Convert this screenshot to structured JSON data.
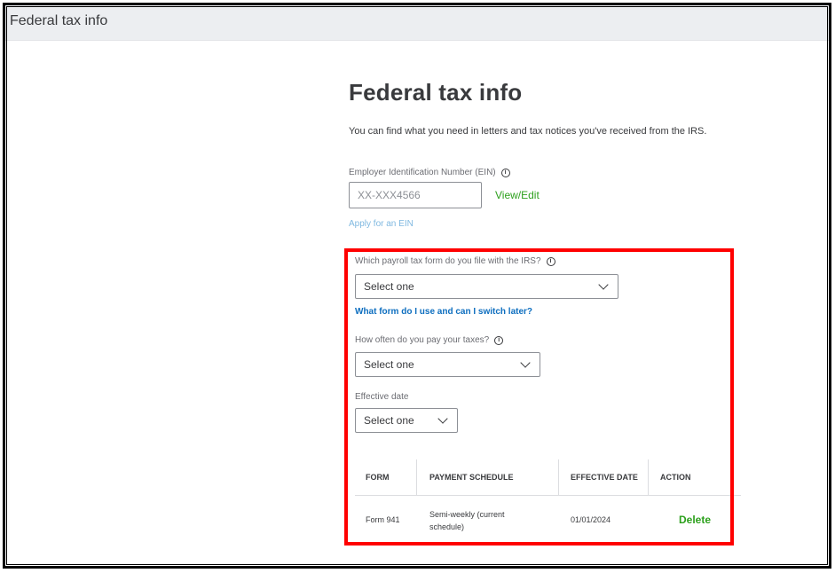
{
  "window": {
    "title": "Federal tax info"
  },
  "page": {
    "title": "Federal tax info",
    "description": "You can find what you need in letters and tax notices you've received from the IRS."
  },
  "ein": {
    "label": "Employer Identification Number (EIN)",
    "value": "XX-XXX4566",
    "view_edit_label": "View/Edit",
    "apply_link": "Apply for an EIN"
  },
  "payroll_form": {
    "label": "Which payroll tax form do you file with the IRS?",
    "selected": "Select one",
    "help_link": "What form do I use and can I switch later?"
  },
  "pay_frequency": {
    "label": "How often do you pay your taxes?",
    "selected": "Select one"
  },
  "effective_date": {
    "label": "Effective date",
    "selected": "Select one"
  },
  "table": {
    "headers": {
      "form": "FORM",
      "payment_schedule": "PAYMENT SCHEDULE",
      "effective_date": "EFFECTIVE DATE",
      "action": "ACTION"
    },
    "rows": [
      {
        "form": "Form 941",
        "payment_schedule": "Semi-weekly (current schedule)",
        "effective_date": "01/01/2024",
        "action": "Delete"
      }
    ]
  },
  "colors": {
    "brand_green": "#2ca01c",
    "link_blue": "#0d6ebf",
    "highlight_red": "#ff0000",
    "topbar_bg": "#eceef1"
  },
  "icons": [
    "info-icon",
    "chevron-down-icon"
  ]
}
